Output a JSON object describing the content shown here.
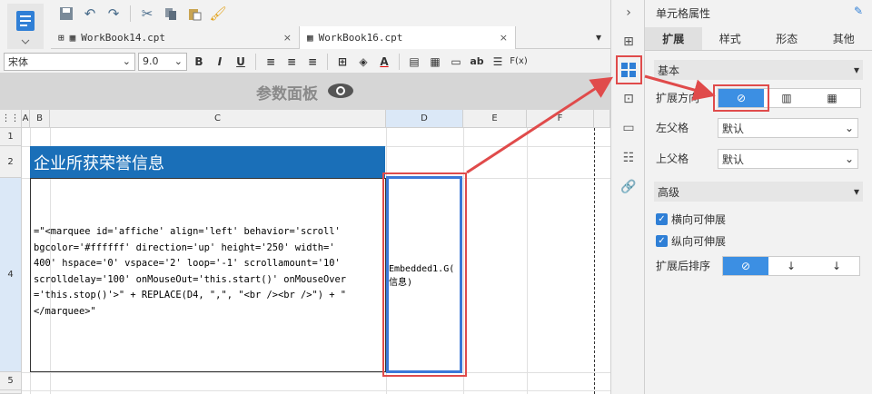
{
  "toolbar": {
    "save": "save-icon",
    "undo": "undo-icon",
    "redo": "redo-icon",
    "cut": "cut-icon",
    "copy": "copy-icon",
    "paste": "paste-icon",
    "brush": "format-brush-icon"
  },
  "tabs": [
    {
      "label": "WorkBook14.cpt",
      "close": "×"
    },
    {
      "label": "WorkBook16.cpt",
      "close": "×"
    }
  ],
  "format_bar": {
    "font": "宋体",
    "size": "9.0",
    "bold": "B",
    "italic": "I",
    "underline": "U",
    "ab": "ab",
    "fx": "F(x)"
  },
  "param_panel": {
    "label": "参数面板"
  },
  "grid": {
    "columns": [
      "A",
      "B",
      "C",
      "D",
      "E",
      "F"
    ],
    "rows": [
      "1",
      "2",
      "4",
      "5"
    ],
    "title_cell": "企业所获荣誉信息",
    "formula_lines": [
      "=\"<marquee id='affiche' align='left' behavior='scroll'",
      "bgcolor='#ffffff' direction='up' height='250' width='",
      "400' hspace='0' vspace='2' loop='-1' scrollamount='10'",
      "scrolldelay='100' onMouseOut='this.start()' onMouseOver",
      "='this.stop()'>\" + REPLACE(D4, \",\", \"<br /><br />\") + \"",
      "</marquee>\""
    ],
    "d_cell_lines": [
      "Embedded1.G(",
      "信息)"
    ]
  },
  "panel": {
    "title": "单元格属性",
    "tabs": [
      "扩展",
      "样式",
      "形态",
      "其他"
    ],
    "section_basic": "基本",
    "expand_direction_label": "扩展方向",
    "left_parent_label": "左父格",
    "left_parent_value": "默认",
    "top_parent_label": "上父格",
    "top_parent_value": "默认",
    "section_advanced": "高级",
    "h_expand": "横向可伸展",
    "v_expand": "纵向可伸展",
    "sort_label": "扩展后排序"
  },
  "colors": {
    "accent": "#3c8fe3",
    "title_bg": "#1a6fb8",
    "highlight": "#e04b4b"
  }
}
